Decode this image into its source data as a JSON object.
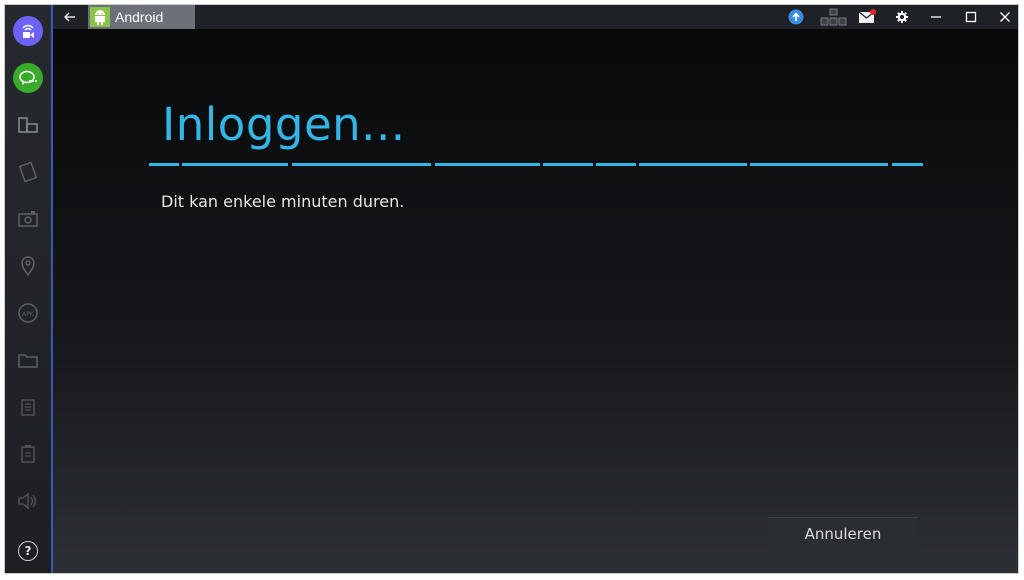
{
  "window": {
    "tab_label": "Android",
    "colors": {
      "accent": "#33b5e5",
      "sidebar_border": "#3b57b8",
      "tab_background": "#6c7078",
      "android_green": "#8bc24a"
    }
  },
  "sidebar": {
    "items": [
      {
        "name": "video-cam-icon",
        "active": true,
        "color": "#6c63f5"
      },
      {
        "name": "chat-icon",
        "active": true,
        "color": "#3aaa2a"
      },
      {
        "name": "rotate-screen-icon"
      },
      {
        "name": "shake-icon"
      },
      {
        "name": "camera-icon"
      },
      {
        "name": "location-pin-icon"
      },
      {
        "name": "apk-icon"
      },
      {
        "name": "folder-icon"
      },
      {
        "name": "copy-icon"
      },
      {
        "name": "paste-icon"
      },
      {
        "name": "volume-icon"
      },
      {
        "name": "help-icon"
      }
    ],
    "help_label": "?",
    "apk_label": "APK"
  },
  "titlebar": {
    "buttons": [
      "back-icon",
      "upload-icon",
      "keyboard-icon",
      "mail-notification-icon",
      "settings-icon",
      "minimize-icon",
      "maximize-icon",
      "close-icon"
    ]
  },
  "login": {
    "title": "Inloggen...",
    "subtitle": "Dit kan enkele minuten duren.",
    "cancel_label": "Annuleren",
    "progress_state": "indeterminate"
  }
}
